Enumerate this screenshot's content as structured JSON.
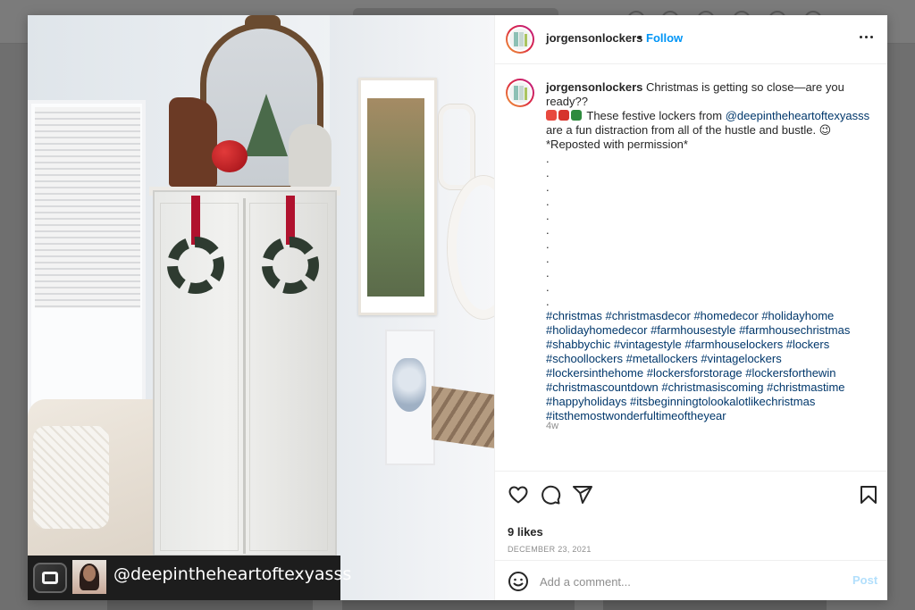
{
  "post": {
    "username": "jorgensonlockers",
    "follow_label": "Follow",
    "separator": "•",
    "caption_user": "jorgensonlockers",
    "caption_text_1": "Christmas is getting so close—are you ready??",
    "caption_text_2": "These festive lockers from",
    "mention": "@deepintheheartoftexyasss",
    "caption_text_3": "are a fun distraction from all of the hustle and bustle. 😉 *Reposted with permission*",
    "dots": [
      ".",
      ".",
      ".",
      ".",
      ".",
      ".",
      ".",
      ".",
      ".",
      ".",
      "."
    ],
    "hashtags": "#christmas #christmasdecor #homedecor #holidayhome #holidayhomedecor #farmhousestyle #farmhousechristmas #shabbychic #vintagestyle #farmhouselockers #lockers #schoollockers #metallockers #vintagelockers #lockersinthehome #lockersforstorage #lockersforthewin #christmascountdown #christmasiscoming #christmastime #happyholidays #itsbeginningtolookalotlikechristmas #itsthemostwonderfultimeoftheyear",
    "caption_time": "4w",
    "likes": "9 likes",
    "date": "DECEMBER 23, 2021"
  },
  "photo": {
    "credit_handle": "@deepintheheartoftexyasss"
  },
  "comment": {
    "placeholder": "Add a comment...",
    "post_label": "Post"
  },
  "icons": {
    "more": "more-options-icon",
    "like": "heart-icon",
    "comment": "comment-icon",
    "share": "share-icon",
    "save": "bookmark-icon",
    "emoji": "emoji-icon"
  },
  "colors": {
    "link": "#0095f6",
    "hashtag": "#00376b",
    "muted": "#8e8e8e",
    "text": "#262626"
  }
}
